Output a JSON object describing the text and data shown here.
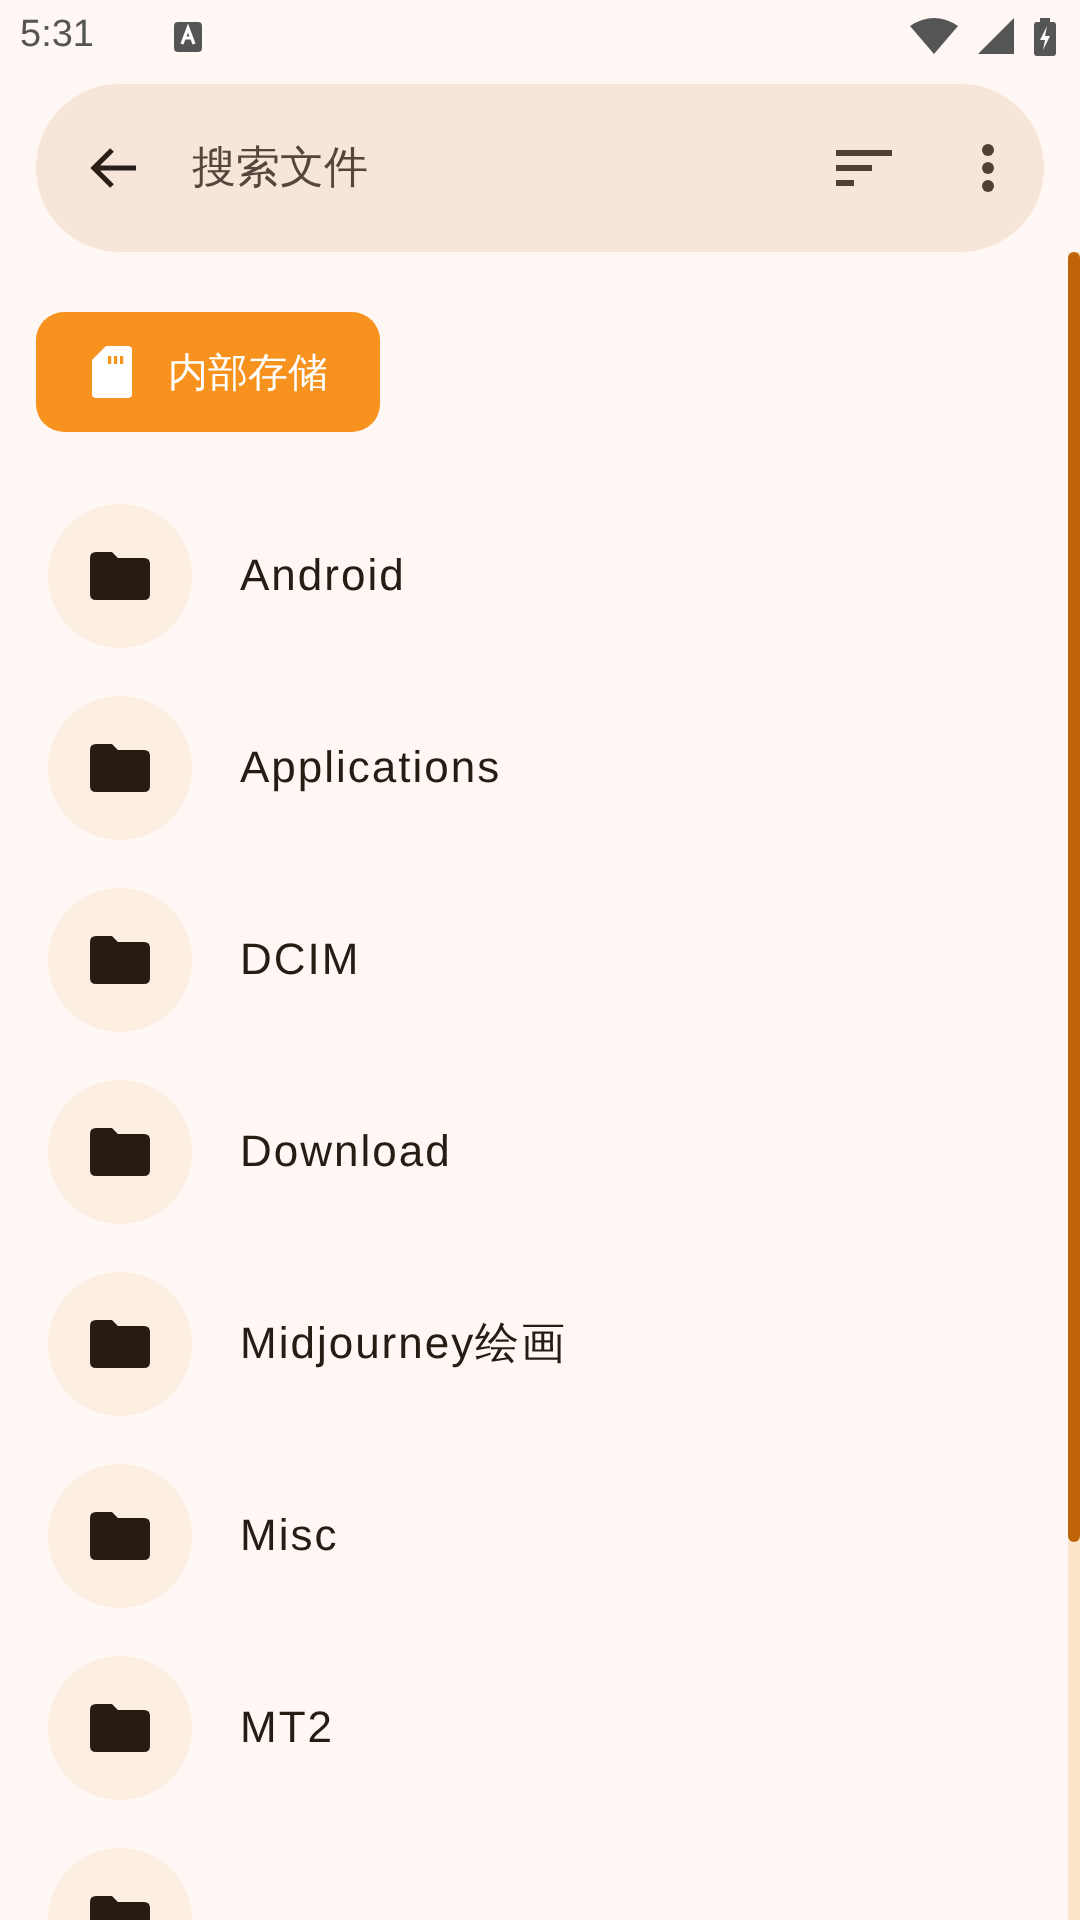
{
  "status_bar": {
    "time": "5:31"
  },
  "search_bar": {
    "placeholder": "搜索文件"
  },
  "storage_chip": {
    "label": "内部存储"
  },
  "folders": [
    {
      "name": "Android"
    },
    {
      "name": "Applications"
    },
    {
      "name": "DCIM"
    },
    {
      "name": "Download"
    },
    {
      "name": "Midjourney绘画"
    },
    {
      "name": "Misc"
    },
    {
      "name": "MT2"
    }
  ],
  "more_folders_below": true
}
